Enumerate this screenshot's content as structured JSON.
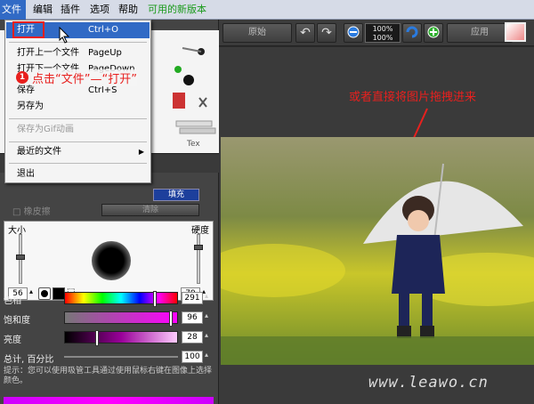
{
  "menubar": {
    "items": [
      "文件",
      "编辑",
      "插件",
      "选项",
      "帮助",
      "可用的新版本"
    ]
  },
  "file_menu": {
    "items": [
      {
        "label": "打开",
        "shortcut": "Ctrl+O"
      },
      {
        "label": "打开上一个文件",
        "shortcut": "PageUp"
      },
      {
        "label": "打开下一个文件",
        "shortcut": "PageDown"
      },
      {
        "label": "保存",
        "shortcut": "Ctrl+S"
      },
      {
        "label": "另存为",
        "shortcut": ""
      },
      {
        "label": "保存为Gif动画",
        "shortcut": ""
      },
      {
        "label": "最近的文件",
        "shortcut": ""
      },
      {
        "label": "退出",
        "shortcut": ""
      }
    ]
  },
  "toolbar": {
    "original_label": "原始",
    "zoom_top": "100%",
    "zoom_bottom": "100%",
    "apply_label": "应用"
  },
  "annotations": {
    "step_number": "1",
    "step_text": "点击“文件”—“打开”",
    "drag_hint": "或者直接将图片拖拽进来",
    "watermark": "www.leawo.cn"
  },
  "panel": {
    "fill_mode": "填充",
    "eraser_label": "橡皮擦",
    "clear_label": "清除",
    "size_label": "大小",
    "hardness_label": "硬度",
    "size_value": "56",
    "hardness_value": "79",
    "hue_label": "色相",
    "hue_value": "291",
    "saturation_label": "饱和度",
    "saturation_value": "96",
    "brightness_label": "亮度",
    "brightness_value": "28",
    "total_label": "总计, 百分比",
    "total_value": "100",
    "hint_text": "提示：您可以使用吸管工具通过使用鼠标右键在图像上选择颜色。"
  },
  "colors": {
    "menu_highlight": "#316ac5",
    "annotation_red": "#e8201e",
    "new_version_green": "#1a9a1a"
  },
  "sliders": {
    "size_fraction": 0.56,
    "hardness_fraction": 0.79,
    "hue_fraction": 0.81,
    "saturation_fraction": 0.96,
    "brightness_fraction": 0.28
  }
}
